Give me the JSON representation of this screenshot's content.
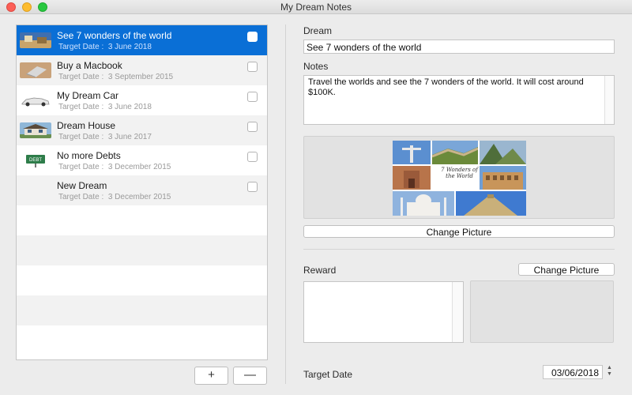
{
  "window": {
    "title": "My Dream Notes"
  },
  "dreams": [
    {
      "title": "See 7 wonders of the world",
      "date_label": "Target Date :",
      "date": "3 June 2018",
      "selected": true
    },
    {
      "title": "Buy a Macbook",
      "date_label": "Target Date :",
      "date": "3 September 2015",
      "selected": false
    },
    {
      "title": "My Dream Car",
      "date_label": "Target Date :",
      "date": "3 June 2018",
      "selected": false
    },
    {
      "title": "Dream House",
      "date_label": "Target Date :",
      "date": "3 June 2017",
      "selected": false
    },
    {
      "title": "No more Debts",
      "date_label": "Target Date :",
      "date": "3 December 2015",
      "selected": false
    },
    {
      "title": "New Dream",
      "date_label": "Target Date :",
      "date": "3 December 2015",
      "selected": false
    }
  ],
  "list_buttons": {
    "add": "+",
    "remove": "—"
  },
  "detail": {
    "dream_label": "Dream",
    "dream_value": "See 7 wonders of the world",
    "notes_label": "Notes",
    "notes_value": "Travel the worlds and see the 7 wonders of the world. It will cost around $100K.",
    "change_picture_label": "Change Picture",
    "collage_text": "7 Wonders of the World",
    "reward_label": "Reward",
    "reward_change_picture_label": "Change Picture",
    "reward_value": "",
    "target_date_label": "Target Date",
    "target_date_value": "03/06/2018",
    "stepper_up": "▲",
    "stepper_down": "▼"
  },
  "colors": {
    "selection": "#0a6fd6",
    "close": "#fc5f57",
    "minimize": "#fdbc2e",
    "maximize": "#28c840"
  },
  "icons": {
    "row_0": "wonders-thumbnail-icon",
    "row_1": "macbook-thumbnail-icon",
    "row_2": "car-thumbnail-icon",
    "row_3": "house-thumbnail-icon",
    "row_4": "debt-sign-thumbnail-icon",
    "row_5": ""
  }
}
